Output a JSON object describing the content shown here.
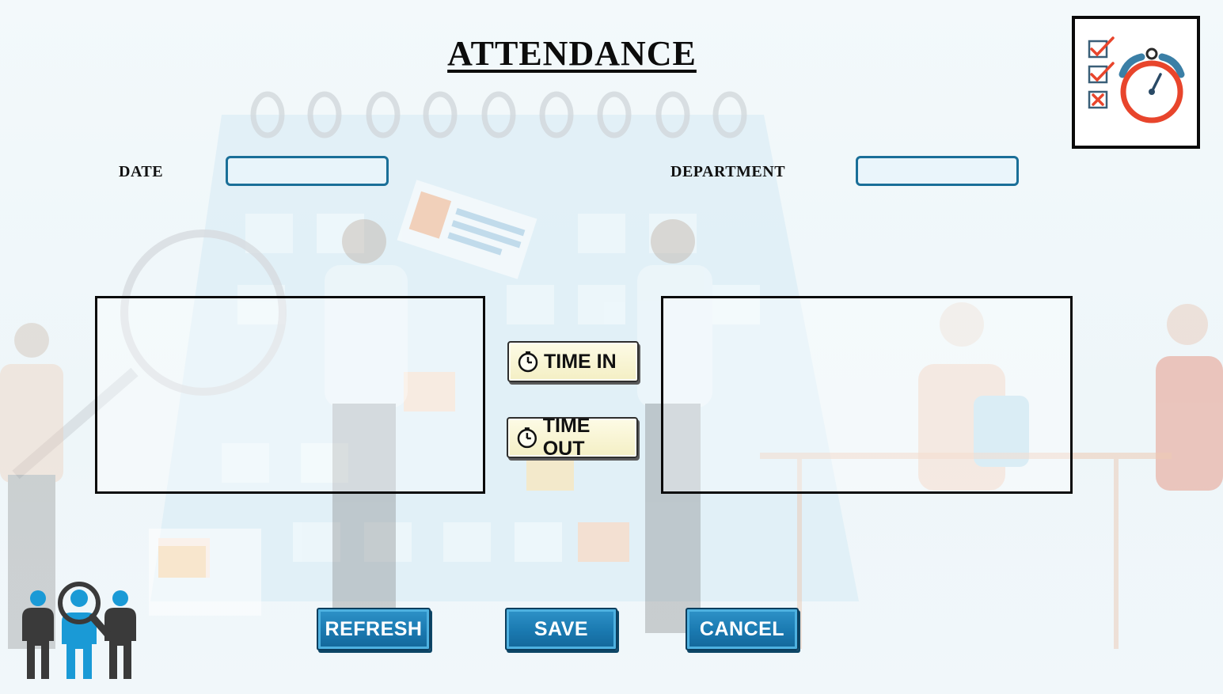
{
  "title": "ATTENDANCE",
  "form": {
    "date_label": "DATE",
    "date_value": "",
    "department_label": "DEPARTMENT",
    "department_value": ""
  },
  "time_buttons": {
    "time_in": "TIME IN",
    "time_out": "TIME OUT"
  },
  "actions": {
    "refresh": "REFRESH",
    "save": "SAVE",
    "cancel": "CANCEL"
  },
  "icons": {
    "logo": "checklist-stopwatch-icon",
    "people": "employee-search-icon",
    "clock": "clock-icon"
  },
  "colors": {
    "field_border": "#1a6f98",
    "action_button": "#1a79b0",
    "time_button": "#f4efc4",
    "stopwatch": "#e8452c",
    "people_blue": "#1a9ad6",
    "people_gray": "#3a3a3a"
  }
}
